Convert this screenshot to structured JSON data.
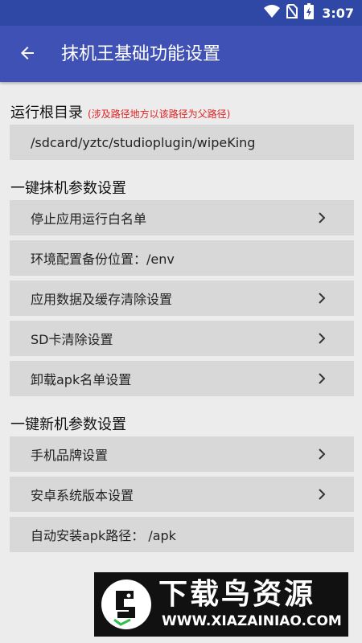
{
  "status_bar": {
    "time": "3:07",
    "icons": [
      "wifi-icon",
      "no-sim-icon",
      "battery-charging-icon"
    ]
  },
  "app_bar": {
    "back_icon": "arrow-left-icon",
    "title": "抹机王基础功能设置"
  },
  "root_dir": {
    "title": "运行根目录",
    "note": "(涉及路径地方以该路径为父路径)",
    "path": "/sdcard/yztc/studioplugin/wipeKing"
  },
  "wipe_section": {
    "title": "一键抹机参数设置",
    "items": [
      {
        "label": "停止应用运行白名单",
        "chevron": true
      },
      {
        "label": "环境配置备份位置：/env",
        "chevron": false
      },
      {
        "label": "应用数据及缓存清除设置",
        "chevron": true
      },
      {
        "label": "SD卡清除设置",
        "chevron": true
      },
      {
        "label": "卸载apk名单设置",
        "chevron": true
      }
    ]
  },
  "new_section": {
    "title": "一键新机参数设置",
    "items": [
      {
        "label": "手机品牌设置",
        "chevron": true
      },
      {
        "label": "安卓系统版本设置",
        "chevron": true
      },
      {
        "label": "自动安装apk路径： /apk",
        "chevron": false
      }
    ]
  },
  "watermark": {
    "text": "下载鸟资源",
    "url": "WWW.XIAZAINIAO.COM"
  },
  "colors": {
    "status_bar": "#2f48a6",
    "app_bar": "#3f51b5",
    "row_bg": "#d8d8d8",
    "note_red": "#e02020"
  }
}
